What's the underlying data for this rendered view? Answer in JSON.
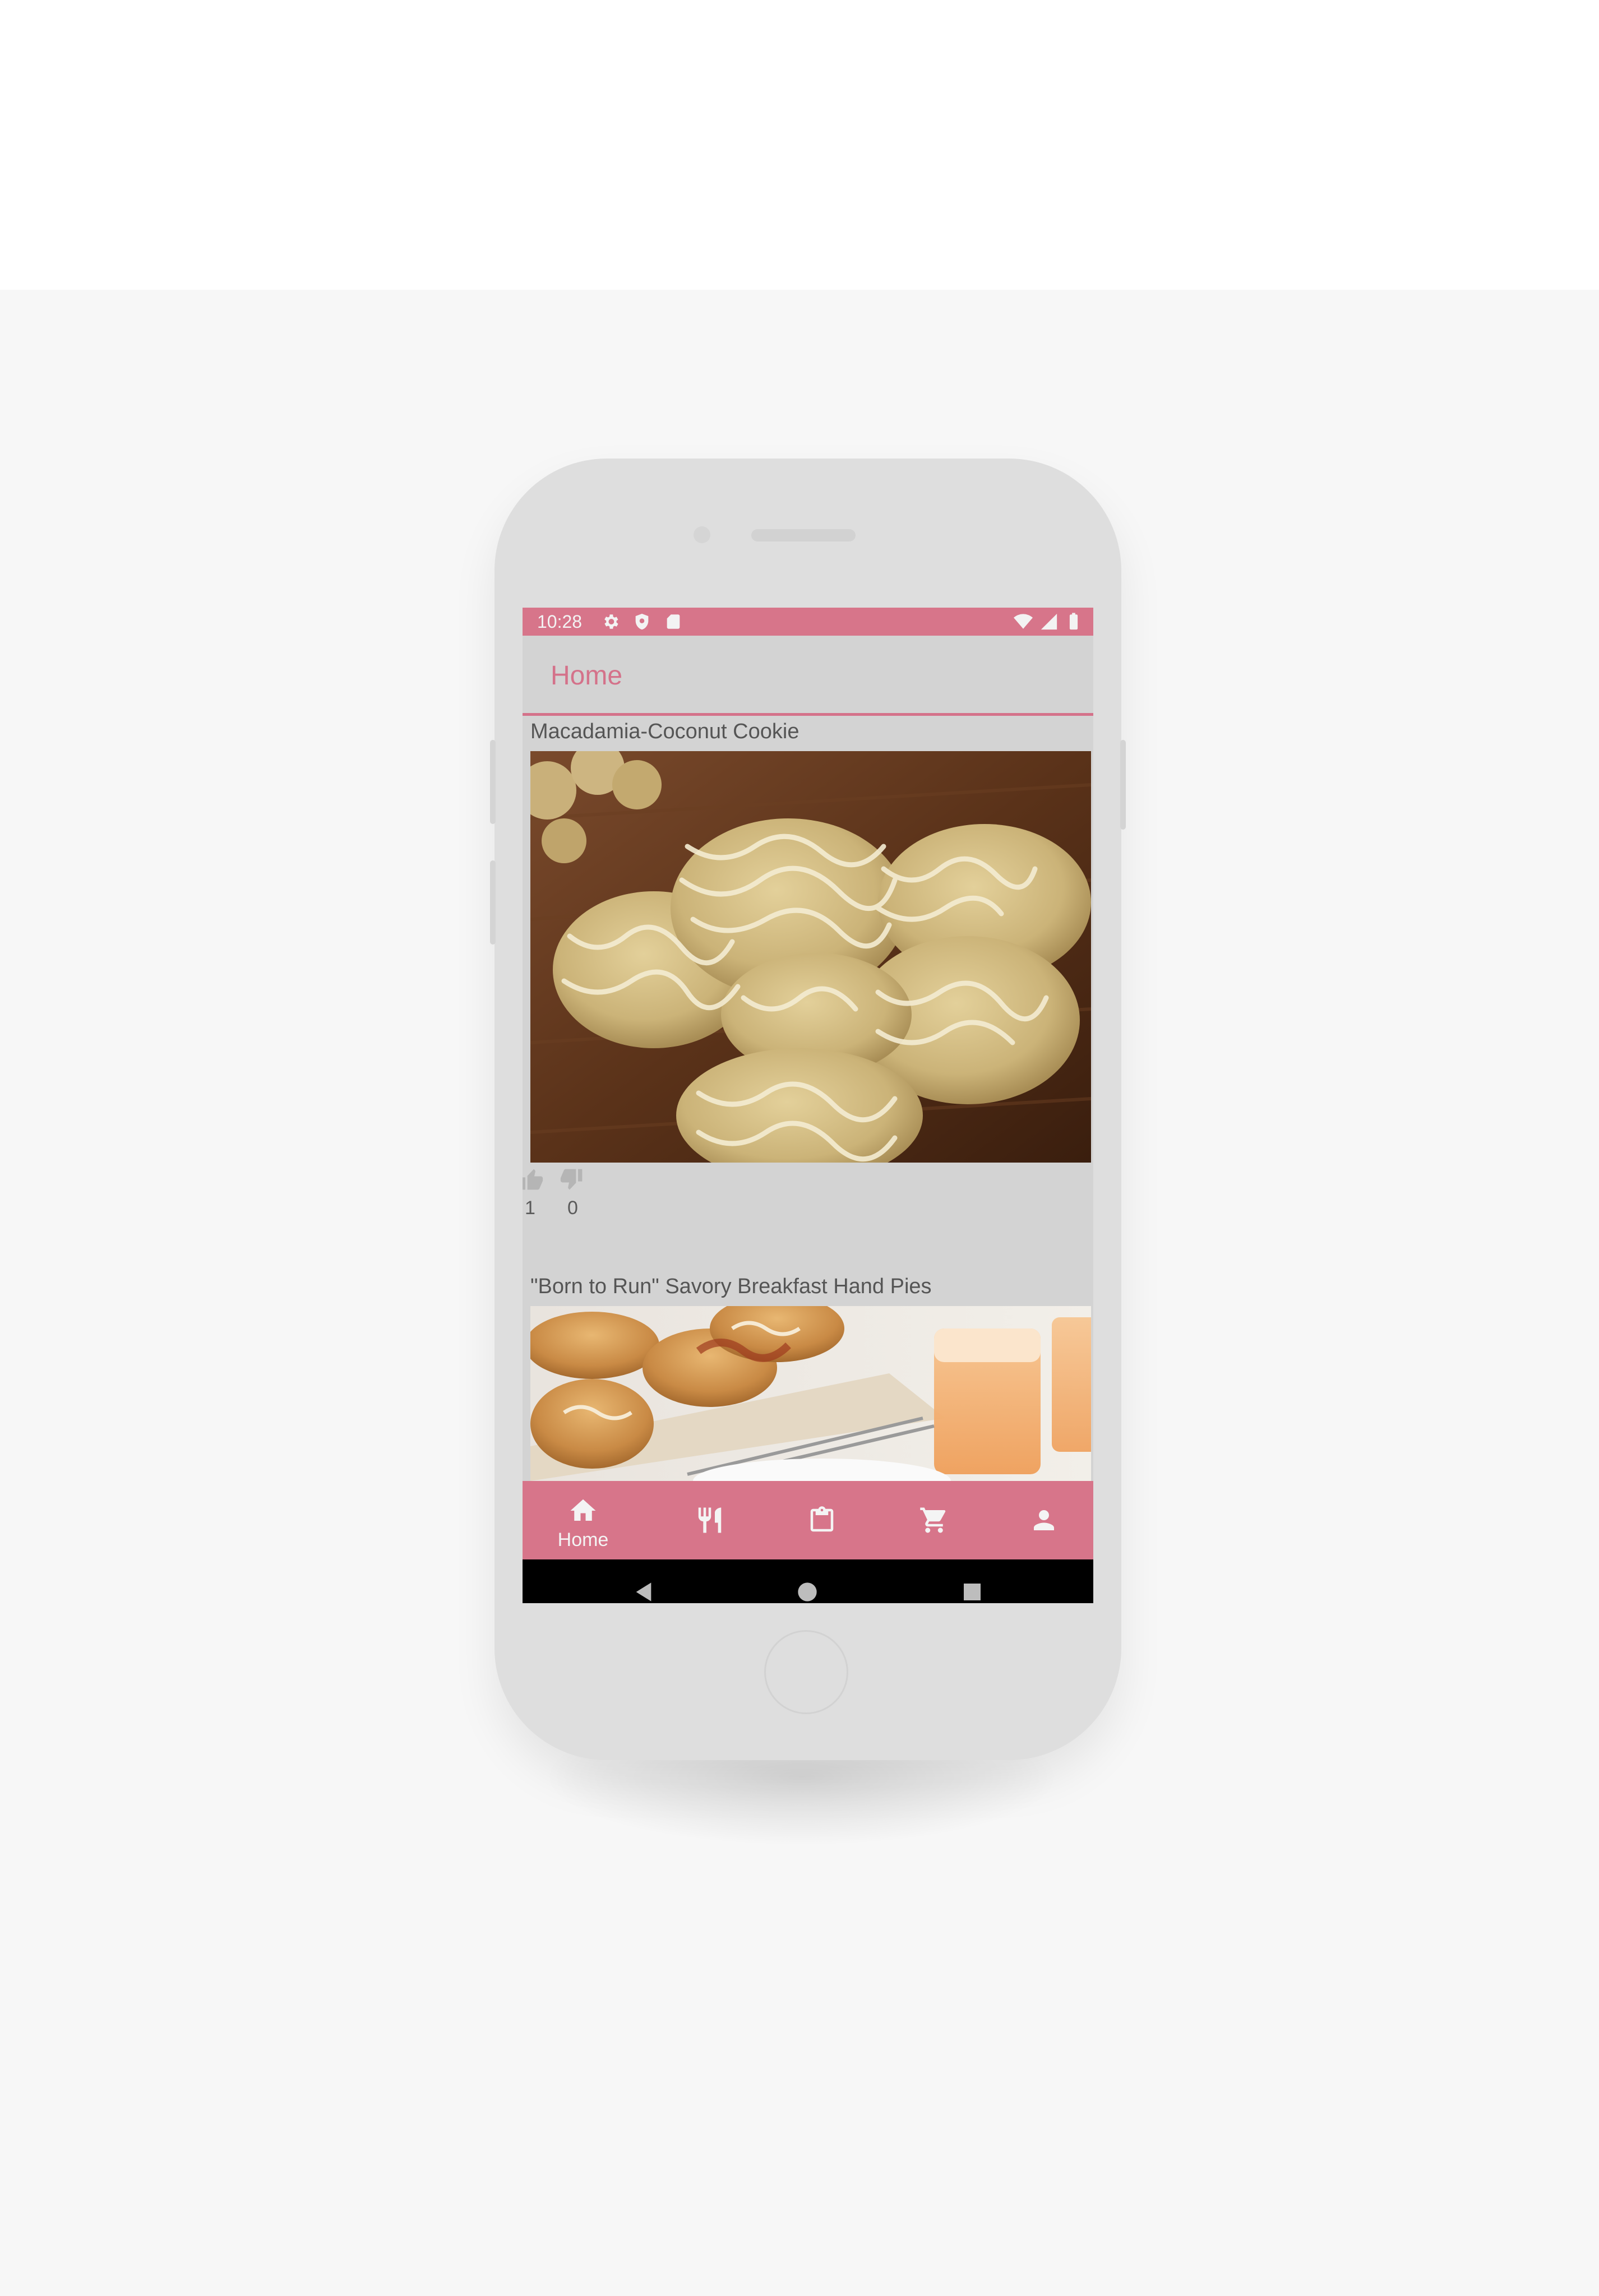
{
  "status_bar": {
    "time": "10:28",
    "left_icons": [
      "gear-icon",
      "shield-icon",
      "sim-card-icon"
    ],
    "right_icons": [
      "wifi-icon",
      "signal-icon",
      "battery-icon"
    ]
  },
  "app_bar": {
    "title": "Home"
  },
  "feed": {
    "items": [
      {
        "title": "Macadamia-Coconut Cookie",
        "likes": "1",
        "dislikes": "0"
      },
      {
        "title": "\"Born to Run\" Savory Breakfast Hand Pies"
      }
    ]
  },
  "bottom_nav": {
    "items": [
      {
        "icon": "home-icon",
        "label": "Home",
        "active": true
      },
      {
        "icon": "fork-knife-icon",
        "label": "",
        "active": false
      },
      {
        "icon": "clipboard-icon",
        "label": "",
        "active": false
      },
      {
        "icon": "cart-icon",
        "label": "",
        "active": false
      },
      {
        "icon": "person-icon",
        "label": "",
        "active": false
      }
    ]
  },
  "colors": {
    "accent": "#d7758a",
    "screen_background": "#d3d3d3",
    "text": "#555555"
  }
}
